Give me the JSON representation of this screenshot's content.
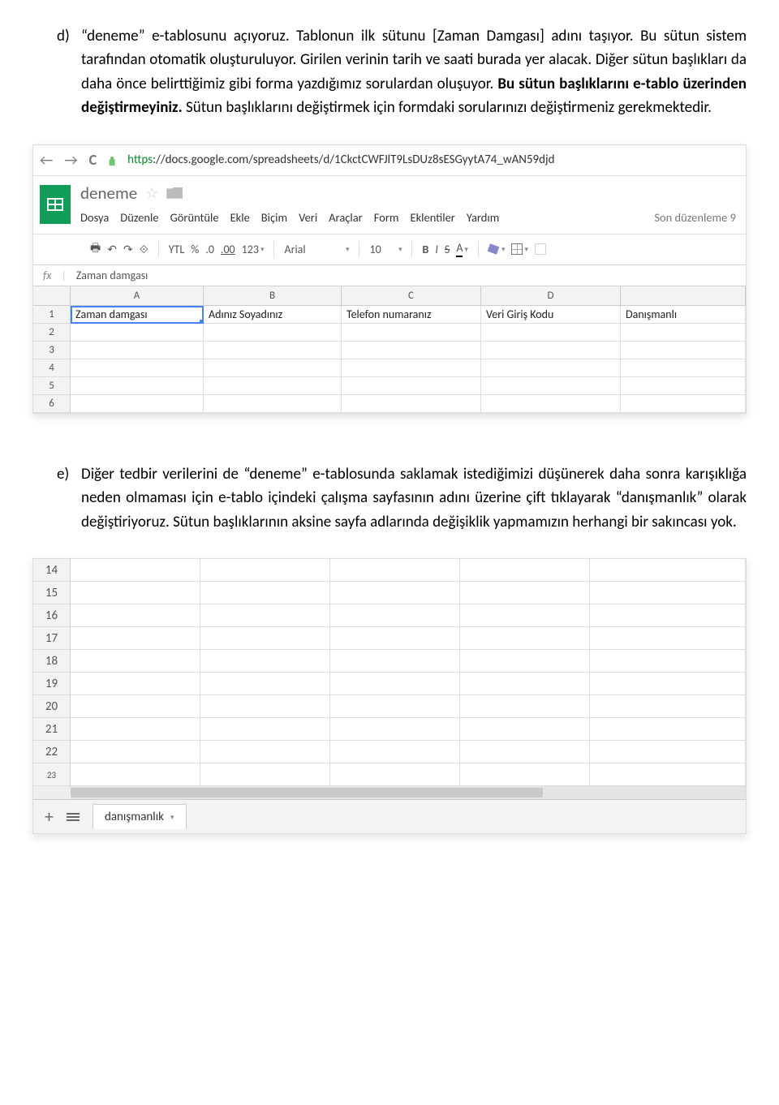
{
  "para_d": {
    "marker": "d)",
    "seg1": "“deneme” e-tablosunu açıyoruz. Tablonun ilk sütunu [Zaman Damgası] adını taşıyor. Bu sütun sistem tarafından otomatik oluşturuluyor. Girilen verinin tarih ve saati burada yer alacak. Diğer sütun başlıkları da daha önce belirttiğimiz gibi forma yazdığımız sorulardan oluşuyor. ",
    "seg2_bold": "Bu sütun başlıklarını e-tablo üzerinden değiştirmeyiniz.",
    "seg3": " Sütun başlıklarını değiştirmek için formdaki sorularınızı değiştirmeniz gerekmektedir."
  },
  "para_e": {
    "marker": "e)",
    "text": "Diğer tedbir verilerini de “deneme” e-tablosunda saklamak istediğimizi düşünerek daha sonra karışıklığa neden olmaması için e-tablo içindeki çalışma sayfasının adını üzerine çift tıklayarak   “danışmanlık” olarak değiştiriyoruz. Sütun başlıklarının aksine sayfa adlarında değişiklik yapmamızın herhangi bir sakıncası yok."
  },
  "browser": {
    "url_https": "https",
    "url_rest": "://docs.google.com/spreadsheets/d/1CkctCWFJlT9LsDUz8sESGyytA74_wAN59djd"
  },
  "doc_title": "deneme",
  "menus": [
    "Dosya",
    "Düzenle",
    "Görüntüle",
    "Ekle",
    "Biçim",
    "Veri",
    "Araçlar",
    "Form",
    "Eklentiler",
    "Yardım"
  ],
  "menu_right": "Son düzenleme 9",
  "toolbar": {
    "currency": "YTL",
    "percent": "%",
    "dec_less": ".0",
    "dec_more": ".00",
    "num_format": "123",
    "font": "Arial",
    "size": "10",
    "bold": "B",
    "italic": "I",
    "strike": "S",
    "textcolor": "A"
  },
  "fx_label": "fx",
  "fx_value": "Zaman damgası",
  "cols": [
    "A",
    "B",
    "C",
    "D"
  ],
  "row1": {
    "A": "Zaman damgası",
    "B": "Adınız Soyadınız",
    "C": "Telefon numaranız",
    "D": "Veri Giriş Kodu",
    "E": "Danışmanlı"
  },
  "top_rows": [
    "1",
    "2",
    "3",
    "4",
    "5",
    "6"
  ],
  "bottom_rows": [
    "14",
    "15",
    "16",
    "17",
    "18",
    "19",
    "20",
    "21",
    "22"
  ],
  "bottom_partial": "23",
  "sheet_tab": "danışmanlık"
}
